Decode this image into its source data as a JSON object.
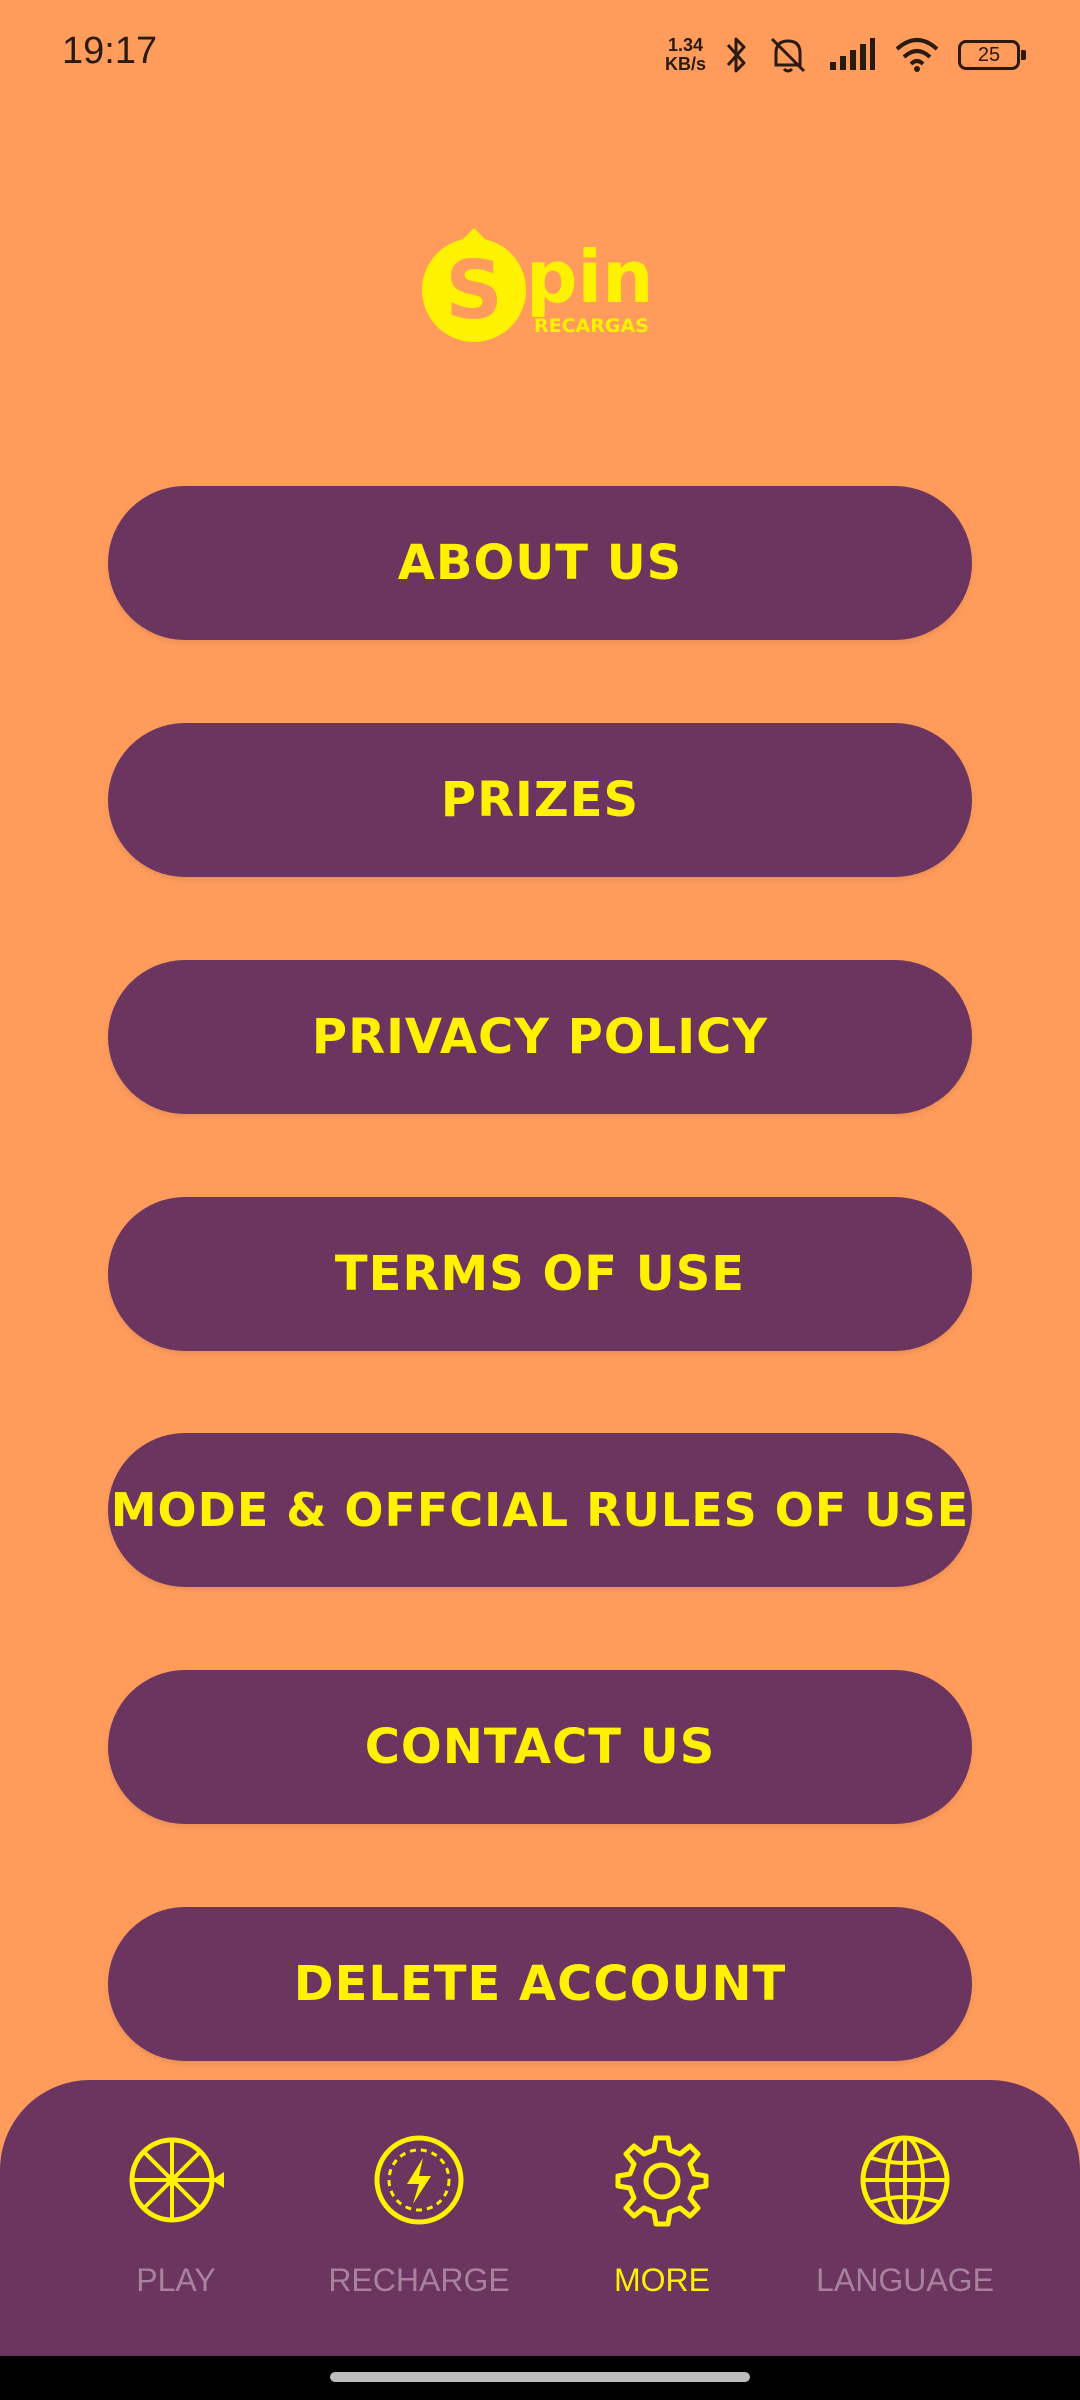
{
  "status_bar": {
    "time": "19:17",
    "net_speed_value": "1.34",
    "net_speed_unit": "KB/s",
    "battery": "25"
  },
  "logo": {
    "letter": "S",
    "word": "pin!",
    "subtitle": "RECARGAS"
  },
  "menu": {
    "about_us": "ABOUT US",
    "prizes": "PRIZES",
    "privacy_policy": "PRIVACY POLICY",
    "terms_of_use": "TERMS OF USE",
    "official_rules": "MODE & OFFCIAL RULES OF USE",
    "contact_us": "CONTACT US",
    "delete_account": "DELETE ACCOUNT"
  },
  "bottom_nav": {
    "play": "PLAY",
    "recharge": "RECHARGE",
    "more": "MORE",
    "language": "LANGUAGE",
    "active": "more"
  },
  "colors": {
    "background": "#FF9C5C",
    "button": "#6B3560",
    "accent": "#FFF200",
    "inactive_label": "#A8819D"
  },
  "icons": {
    "play": "wheel-icon",
    "recharge": "lightning-coin-icon",
    "more": "gear-icon",
    "language": "globe-icon"
  }
}
